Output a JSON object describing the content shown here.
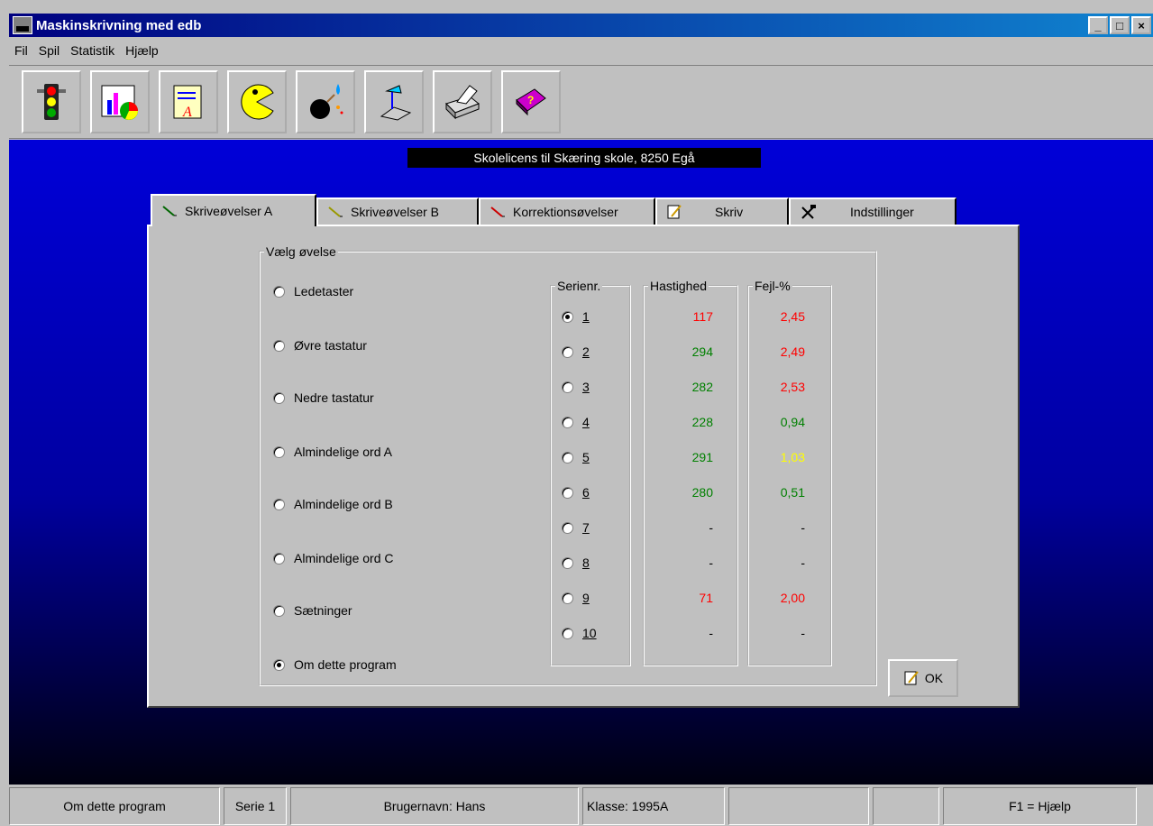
{
  "window": {
    "title": "Maskinskrivning med edb",
    "min_label": "_",
    "max_label": "□",
    "close_label": "×"
  },
  "menu": {
    "items": [
      "Fil",
      "Spil",
      "Statistik",
      "Hjælp"
    ]
  },
  "toolbar": {
    "buttons": [
      "traffic-light-icon",
      "chart-icon",
      "document-icon",
      "pacman-icon",
      "bomb-icon",
      "lamp-icon",
      "printer-icon",
      "help-book-icon"
    ]
  },
  "license": "Skolelicens til  Skæring skole,  8250  Egå",
  "tabs": [
    {
      "label": "Skriveøvelser A",
      "icon": "pen-icon"
    },
    {
      "label": "Skriveøvelser B",
      "icon": "pen-icon"
    },
    {
      "label": "Korrektionsøvelser",
      "icon": "eraser-pen-icon"
    },
    {
      "label": "Skriv",
      "icon": "notepad-icon"
    },
    {
      "label": "Indstillinger",
      "icon": "tools-icon"
    }
  ],
  "exercise_group": {
    "title": "Vælg øvelse",
    "options": [
      "Ledetaster",
      "Øvre tastatur",
      "Nedre tastatur",
      "Almindelige ord A",
      "Almindelige ord B",
      "Almindelige ord C",
      "Sætninger",
      "Om dette program"
    ],
    "selected": "Om dette program"
  },
  "serie_group": {
    "title": "Serienr.",
    "options": [
      "1",
      "2",
      "3",
      "4",
      "5",
      "6",
      "7",
      "8",
      "9",
      "10"
    ],
    "selected": "1"
  },
  "speed_group": {
    "title": "Hastighed",
    "values": [
      "117",
      "294",
      "282",
      "228",
      "291",
      "280",
      "-",
      "-",
      "71",
      "-"
    ]
  },
  "error_group": {
    "title": "Fejl-%",
    "values": [
      "2,45",
      "2,49",
      "2,53",
      "0,94",
      "1,03",
      "0,51",
      "-",
      "-",
      "2,00",
      "-"
    ]
  },
  "colors": {
    "speed": [
      "red",
      "green",
      "green",
      "green",
      "green",
      "green",
      "gray",
      "gray",
      "red",
      "gray"
    ],
    "error": [
      "red",
      "red",
      "red",
      "green",
      "yellow",
      "green",
      "gray",
      "gray",
      "red",
      "gray"
    ]
  },
  "ok_label": "OK",
  "status": {
    "cells": [
      "Om dette program",
      "Serie  1",
      "Brugernavn: Hans",
      "Klasse: 1995A",
      "",
      "",
      "F1 = Hjælp"
    ]
  }
}
